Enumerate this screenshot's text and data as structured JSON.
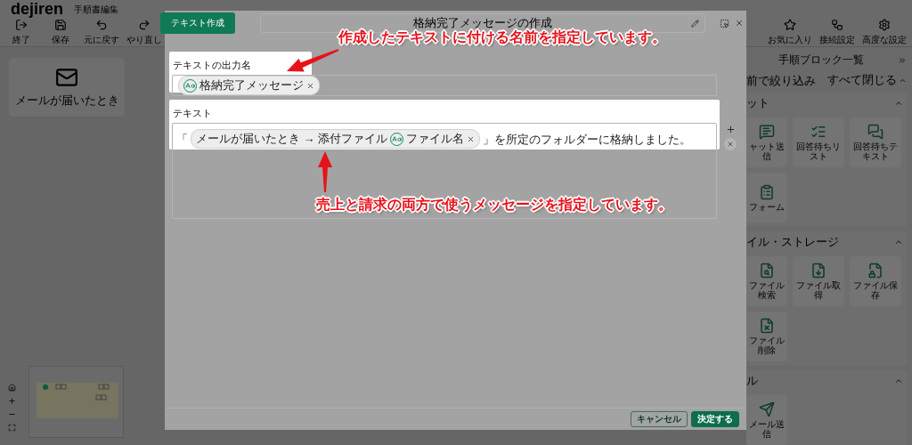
{
  "app": {
    "logo": "dejiren",
    "page_title": "手順書編集",
    "toolbar_left": [
      {
        "label": "終了"
      },
      {
        "label": "保存"
      },
      {
        "label": "元に戻す"
      },
      {
        "label": "やり直し"
      }
    ],
    "toolbar_right": [
      {
        "label": "お気に入り"
      },
      {
        "label": "接続設定"
      },
      {
        "label": "高度な設定"
      }
    ]
  },
  "canvas": {
    "nodes": [
      {
        "label": "メールが届いたとき"
      }
    ]
  },
  "block_panel": {
    "title": "手順ブロック一覧",
    "filter_placeholder": "前で絞り込み",
    "collapse_all": "すべて閉じる",
    "sections": [
      {
        "title": "ット",
        "expanded": true,
        "blocks": [
          {
            "label": "ャット送信"
          },
          {
            "label": "回答待ちリスト"
          },
          {
            "label": "回答待ちテキスト"
          },
          {
            "label": "フォーム"
          }
        ]
      },
      {
        "title": "イル・ストレージ",
        "expanded": true,
        "blocks": [
          {
            "label": "ファイル検索"
          },
          {
            "label": "ファイル取得"
          },
          {
            "label": "ファイル保存"
          },
          {
            "label": "ファイル削除"
          }
        ]
      },
      {
        "title": "ル",
        "expanded": true,
        "blocks": [
          {
            "label": "メール送信"
          }
        ]
      }
    ]
  },
  "dialog": {
    "tab": "テキスト作成",
    "title": "格納完了メッセージの作成",
    "output_name": {
      "label": "テキストの出力名",
      "chips": [
        {
          "text": "格納完了メッセージ"
        }
      ]
    },
    "text": {
      "label": "テキスト",
      "segments": [
        {
          "kind": "text",
          "text": "「"
        },
        {
          "kind": "chip",
          "path": "メールが届いたとき → 添付ファイル",
          "text": "ファイル名"
        },
        {
          "kind": "text",
          "text": "」を所定のフォルダーに格納しました。"
        }
      ]
    },
    "buttons": [
      {
        "label": "キャンセル",
        "kind": "secondary"
      },
      {
        "label": "決定する",
        "kind": "primary"
      }
    ]
  },
  "annotations": [
    {
      "text": "作成したテキストに付ける名前を指定しています。"
    },
    {
      "text": "売上と請求の両方で使うメッセージを指定しています。"
    }
  ]
}
